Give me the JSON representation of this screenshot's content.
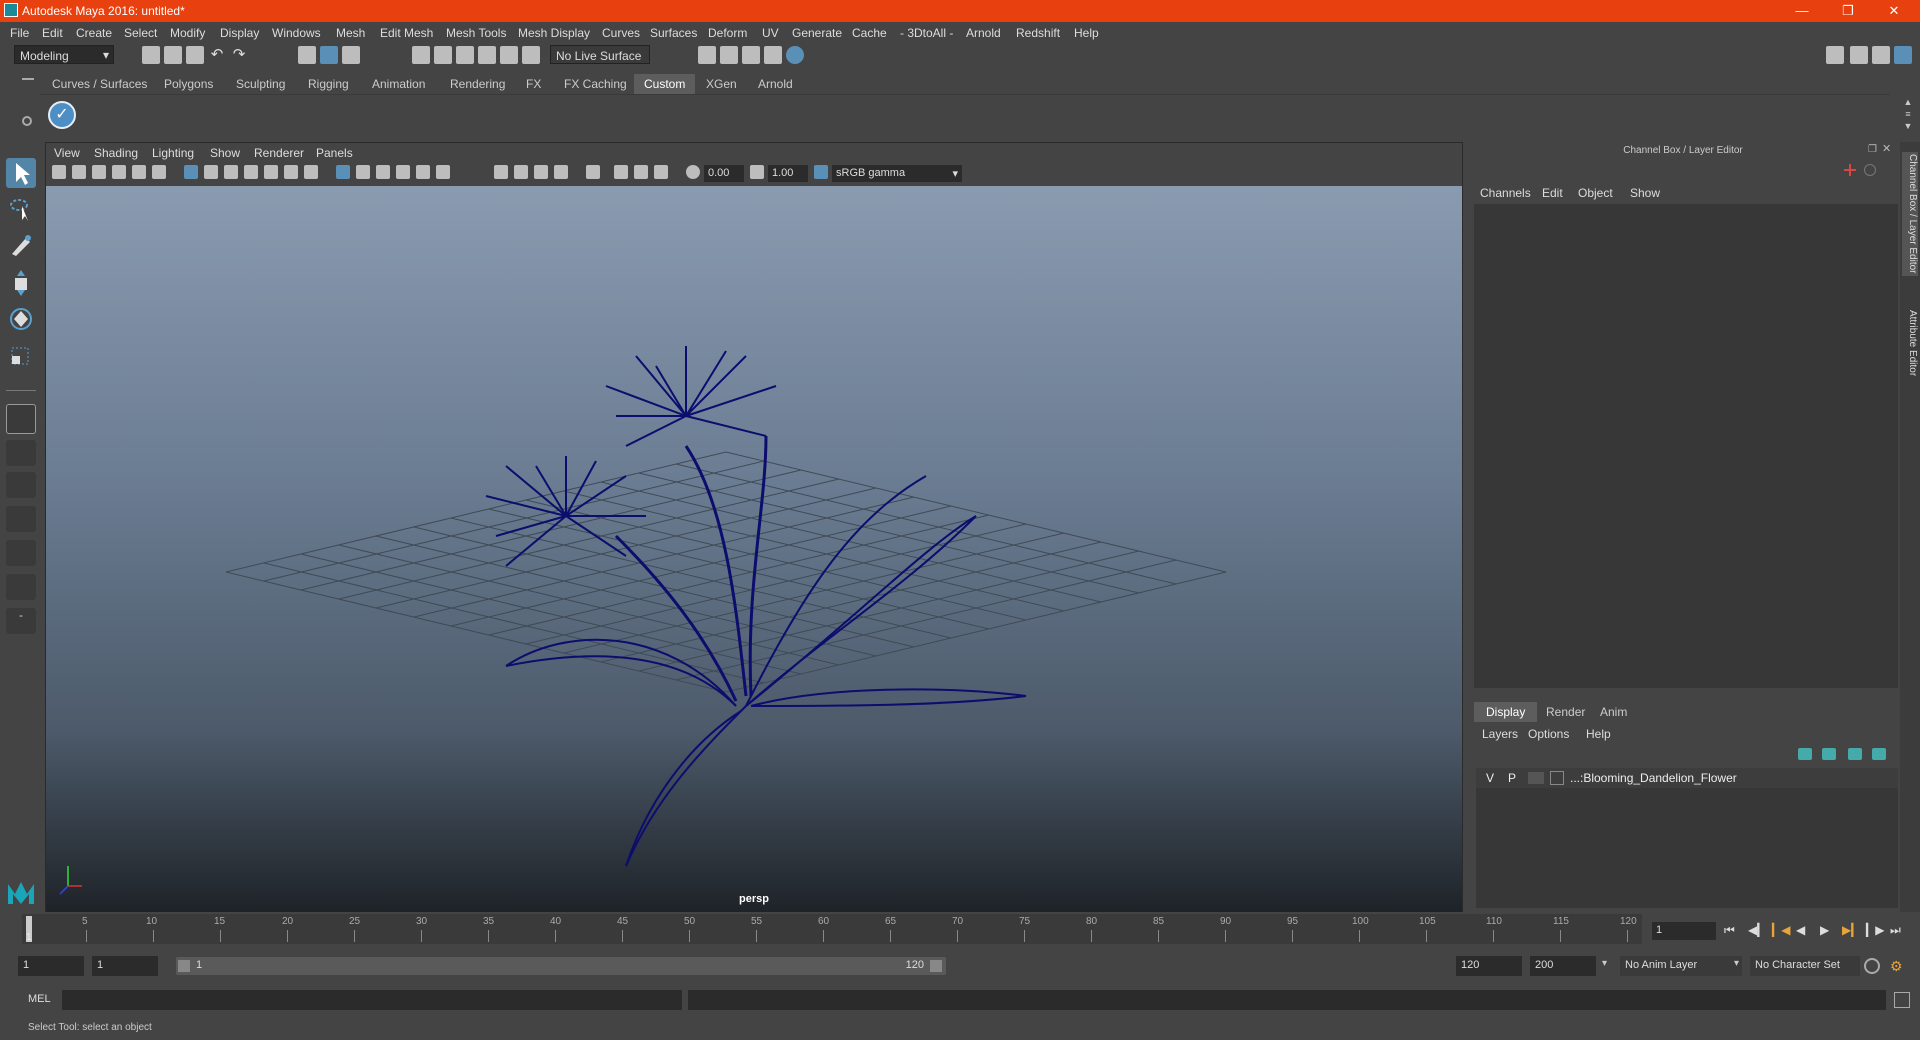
{
  "window": {
    "title": "Autodesk Maya 2016: untitled*"
  },
  "menus": [
    "File",
    "Edit",
    "Create",
    "Select",
    "Modify",
    "Display",
    "Windows",
    "Mesh",
    "Edit Mesh",
    "Mesh Tools",
    "Mesh Display",
    "Curves",
    "Surfaces",
    "Deform",
    "UV",
    "Generate",
    "Cache",
    "- 3DtoAll -",
    "Arnold",
    "Redshift",
    "Help"
  ],
  "statusline": {
    "mode": "Modeling",
    "live_surface": "No Live Surface"
  },
  "shelf_tabs": [
    "Curves / Surfaces",
    "Polygons",
    "Sculpting",
    "Rigging",
    "Animation",
    "Rendering",
    "FX",
    "FX Caching",
    "Custom",
    "XGen",
    "Arnold"
  ],
  "shelf_active": "Custom",
  "panel_menus": [
    "View",
    "Shading",
    "Lighting",
    "Show",
    "Renderer",
    "Panels"
  ],
  "panel_toolbar": {
    "exposure": "0.00",
    "gamma": "1.00",
    "color_space": "sRGB gamma"
  },
  "viewport": {
    "camera": "persp"
  },
  "channel_box": {
    "title": "Channel Box / Layer Editor",
    "menus": [
      "Channels",
      "Edit",
      "Object",
      "Show"
    ],
    "layer_tabs": [
      "Display",
      "Render",
      "Anim"
    ],
    "layer_menus": [
      "Layers",
      "Options",
      "Help"
    ],
    "layer": {
      "v": "V",
      "p": "P",
      "name": "...:Blooming_Dandelion_Flower"
    }
  },
  "side_tabs": [
    "Channel Box / Layer Editor",
    "Attribute Editor"
  ],
  "timeline": {
    "ticks": [
      "5",
      "10",
      "15",
      "20",
      "25",
      "30",
      "35",
      "40",
      "45",
      "50",
      "55",
      "60",
      "65",
      "70",
      "75",
      "80",
      "85",
      "90",
      "95",
      "100",
      "105",
      "110",
      "115",
      "120"
    ],
    "current_frame": "1",
    "start_marker": "1"
  },
  "range": {
    "start": "1",
    "playback_start": "1",
    "slider_start": "1",
    "slider_end": "120",
    "playback_end": "120",
    "end": "200",
    "anim_layer": "No Anim Layer",
    "character_set": "No Character Set"
  },
  "command_line": {
    "label": "MEL"
  },
  "help_line": "Select Tool: select an object",
  "colors": {
    "titlebar": "#e8410f",
    "active_tool": "#5285a6",
    "wireframe": "#0d0d6e"
  }
}
